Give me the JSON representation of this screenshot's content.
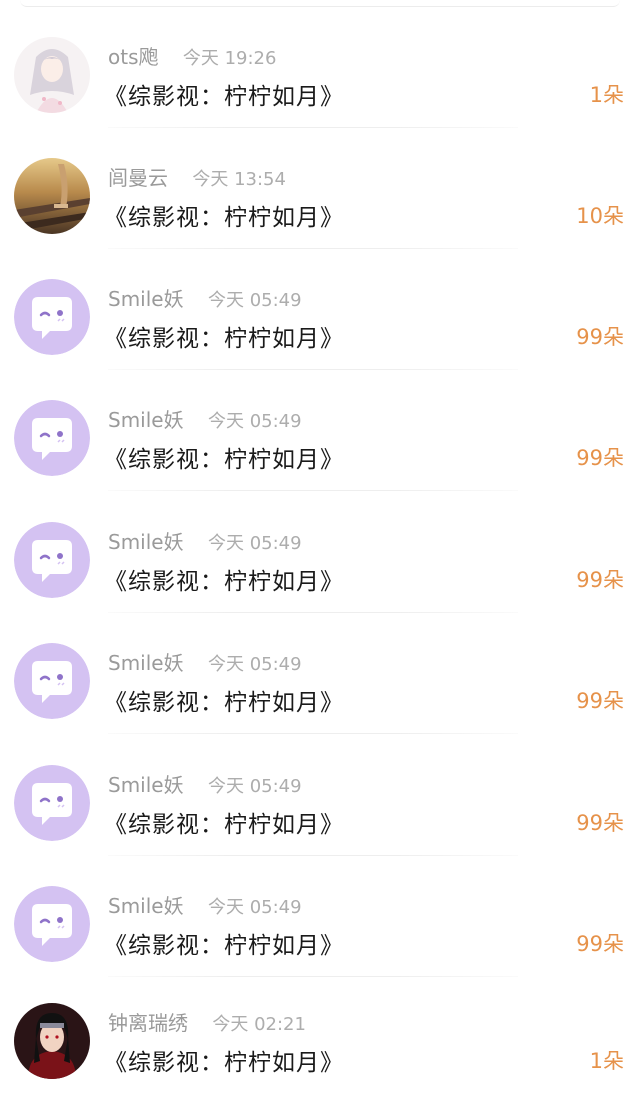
{
  "colors": {
    "count": "#e6924a",
    "avatar_default_bg": "#d4c2f2",
    "avatar_default_icon": "#ffffff",
    "avatar_default_eye": "#8f73c9"
  },
  "gifts": [
    {
      "name": "ots飑",
      "time": "今天 19:26",
      "title": "《综影视：柠柠如月》",
      "count": "1朵",
      "avatar": "anime-girl-avatar"
    },
    {
      "name": "闾曼云",
      "time": "今天 13:54",
      "title": "《综影视：柠柠如月》",
      "count": "10朵",
      "avatar": "railway-photo-avatar"
    },
    {
      "name": "Smile妖",
      "time": "今天 05:49",
      "title": "《综影视：柠柠如月》",
      "count": "99朵",
      "avatar": "default-chat-avatar"
    },
    {
      "name": "Smile妖",
      "time": "今天 05:49",
      "title": "《综影视：柠柠如月》",
      "count": "99朵",
      "avatar": "default-chat-avatar"
    },
    {
      "name": "Smile妖",
      "time": "今天 05:49",
      "title": "《综影视：柠柠如月》",
      "count": "99朵",
      "avatar": "default-chat-avatar"
    },
    {
      "name": "Smile妖",
      "time": "今天 05:49",
      "title": "《综影视：柠柠如月》",
      "count": "99朵",
      "avatar": "default-chat-avatar"
    },
    {
      "name": "Smile妖",
      "time": "今天 05:49",
      "title": "《综影视：柠柠如月》",
      "count": "99朵",
      "avatar": "default-chat-avatar"
    },
    {
      "name": "Smile妖",
      "time": "今天 05:49",
      "title": "《综影视：柠柠如月》",
      "count": "99朵",
      "avatar": "default-chat-avatar"
    },
    {
      "name": "钟离瑞绣",
      "time": "今天 02:21",
      "title": "《综影视：柠柠如月》",
      "count": "1朵",
      "avatar": "anime-ninja-avatar"
    }
  ]
}
